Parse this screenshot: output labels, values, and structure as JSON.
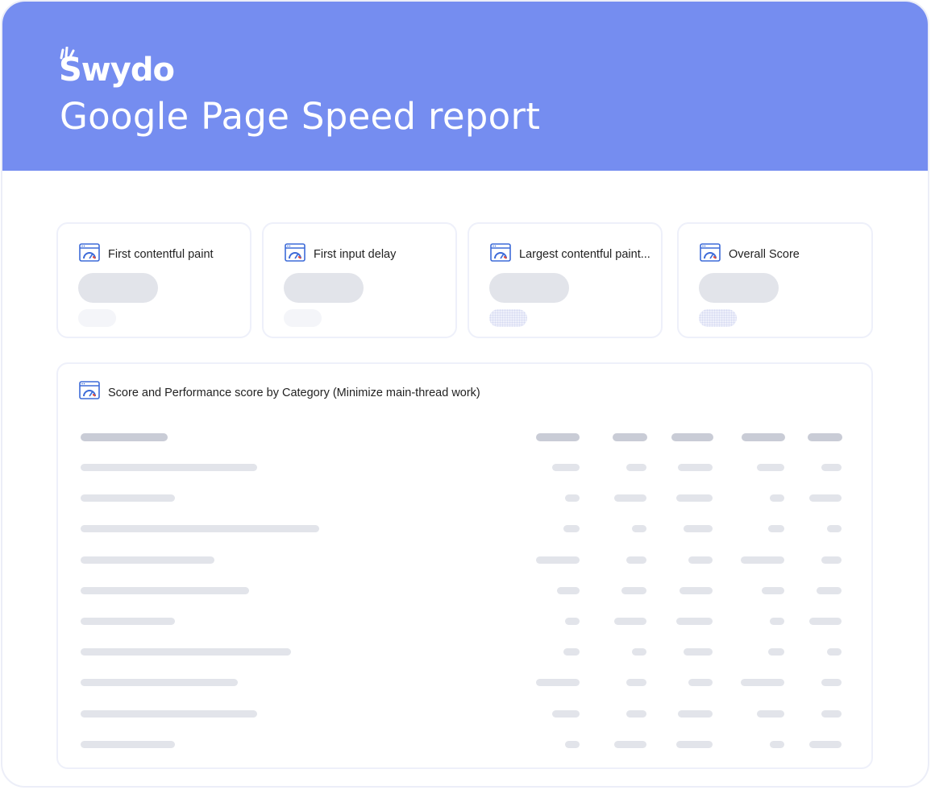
{
  "brand": {
    "logo_text": "Swydo"
  },
  "header": {
    "title": "Google Page Speed report"
  },
  "colors": {
    "header_bg": "#758df0",
    "icon_accent": "#3d6bd8",
    "skeleton": "#e2e4ea",
    "skeleton_header": "#c9ccd6"
  },
  "kpi_cards": [
    {
      "label": "First contentful paint",
      "icon": "pagespeed-gauge-icon"
    },
    {
      "label": "First input delay",
      "icon": "pagespeed-gauge-icon"
    },
    {
      "label": "Largest contentful paint...",
      "icon": "pagespeed-gauge-icon"
    },
    {
      "label": "Overall Score",
      "icon": "pagespeed-gauge-icon"
    }
  ],
  "table": {
    "title": "Score and Performance score by Category (Minimize main-thread work)",
    "icon": "pagespeed-gauge-icon",
    "state": "loading placeholder",
    "columns": 6,
    "rows": 10
  }
}
